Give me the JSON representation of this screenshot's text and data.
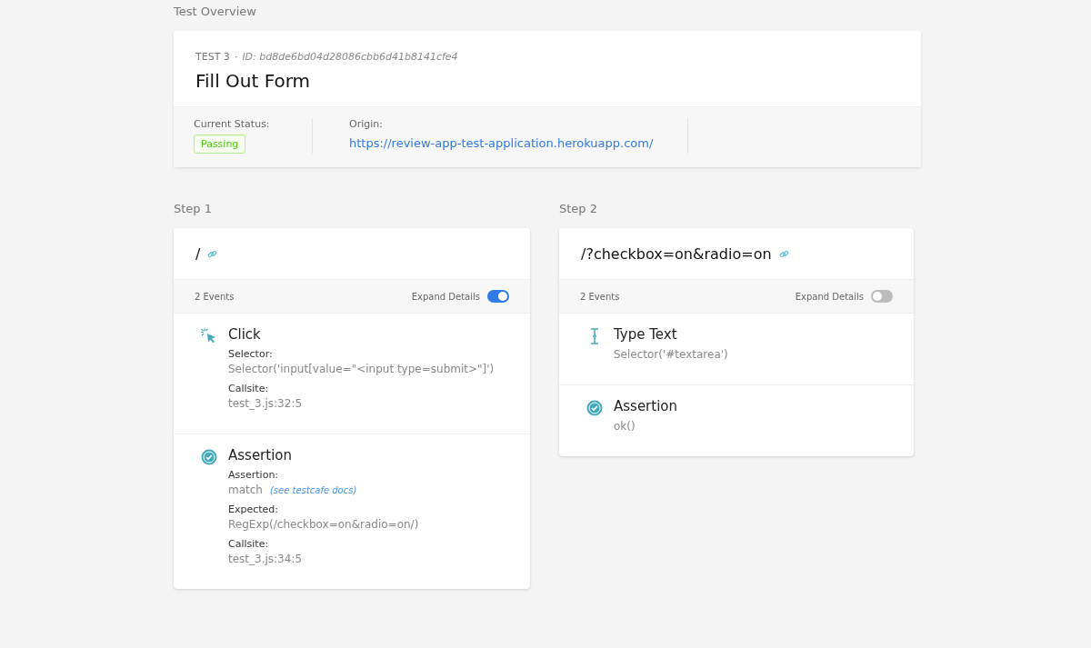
{
  "section_title": "Test Overview",
  "test": {
    "number": "TEST 3",
    "separator": "·",
    "id": "ID: bd8de6bd04d28086cbb6d41b8141cfe4",
    "name": "Fill Out Form",
    "status_label": "Current Status:",
    "status": "Passing",
    "origin_label": "Origin:",
    "origin": "https://review-app-test-application.herokuapp.com/"
  },
  "steps": [
    {
      "title": "Step 1",
      "path": "/",
      "events_count": "2 Events",
      "expand_label": "Expand Details",
      "expanded": true,
      "events": [
        {
          "kind": "click",
          "name": "Click",
          "fields": [
            {
              "label": "Selector:",
              "value": "Selector('input[value=\"<input type=submit>\"]')"
            },
            {
              "label": "Callsite:",
              "value": "test_3.js:32:5"
            }
          ]
        },
        {
          "kind": "assertion",
          "name": "Assertion",
          "fields": [
            {
              "label": "Assertion:",
              "value": "match",
              "link": "(see testcafe docs)"
            },
            {
              "label": "Expected:",
              "value": "RegExp(/checkbox=on&radio=on/)"
            },
            {
              "label": "Callsite:",
              "value": "test_3.js:34:5"
            }
          ]
        }
      ]
    },
    {
      "title": "Step 2",
      "path": "/?checkbox=on&radio=on",
      "events_count": "2 Events",
      "expand_label": "Expand Details",
      "expanded": false,
      "events": [
        {
          "kind": "type",
          "name": "Type Text",
          "fields": [
            {
              "value": "Selector('#textarea')"
            }
          ]
        },
        {
          "kind": "assertion",
          "name": "Assertion",
          "fields": [
            {
              "value": "ok()"
            }
          ]
        }
      ]
    }
  ]
}
